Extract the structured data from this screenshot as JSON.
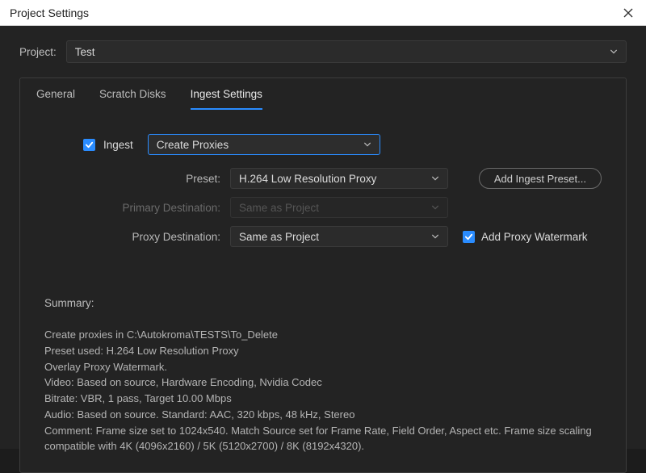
{
  "window": {
    "title": "Project Settings"
  },
  "project": {
    "label": "Project:",
    "value": "Test"
  },
  "tabs": {
    "general": "General",
    "scratch": "Scratch Disks",
    "ingest": "Ingest Settings"
  },
  "ingest": {
    "checkbox_label": "Ingest",
    "action": "Create Proxies",
    "preset_label": "Preset:",
    "preset_value": "H.264 Low Resolution Proxy",
    "primary_label": "Primary Destination:",
    "primary_value": "Same as Project",
    "proxy_label": "Proxy Destination:",
    "proxy_value": "Same as Project",
    "add_preset_btn": "Add Ingest Preset...",
    "watermark_label": "Add Proxy Watermark"
  },
  "summary": {
    "title": "Summary:",
    "line1": "Create proxies in C:\\Autokroma\\TESTS\\To_Delete",
    "line2": "Preset used: H.264 Low Resolution Proxy",
    "line3": "Overlay Proxy Watermark.",
    "line4": "Video: Based on source, Hardware Encoding, Nvidia Codec",
    "line5": "Bitrate: VBR, 1 pass, Target 10.00 Mbps",
    "line6": "Audio: Based on source. Standard: AAC, 320 kbps, 48 kHz, Stereo",
    "line7": "Comment: Frame size set to 1024x540. Match Source set for Frame Rate, Field Order, Aspect etc. Frame size scaling compatible with 4K (4096x2160) / 5K (5120x2700) / 8K (8192x4320)."
  }
}
